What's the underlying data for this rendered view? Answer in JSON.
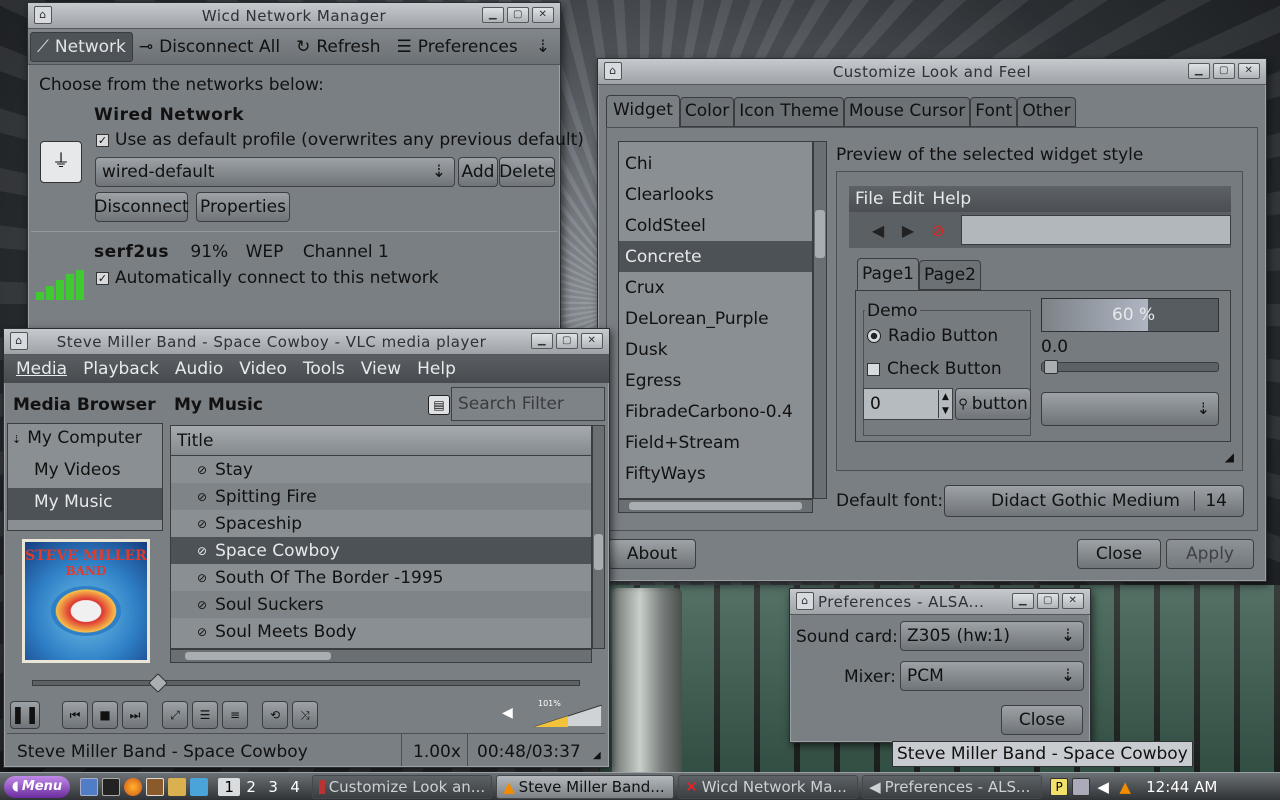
{
  "wicd": {
    "title": "Wicd Network Manager",
    "toolbar": {
      "network": "Network",
      "disconnect_all": "Disconnect All",
      "refresh": "Refresh",
      "preferences": "Preferences"
    },
    "prompt": "Choose from the networks below:",
    "wired": {
      "title": "Wired Network",
      "default_profile": "Use as default profile (overwrites any previous default)",
      "profile": "wired-default",
      "add": "Add",
      "delete": "Delete",
      "disconnect": "Disconnect",
      "properties": "Properties"
    },
    "wireless": {
      "ssid": "serf2us",
      "signal": "91%",
      "enc": "WEP",
      "channel": "Channel 1",
      "auto": "Automatically connect to this network"
    }
  },
  "clook": {
    "title": "Customize Look and Feel",
    "tabs": [
      "Widget",
      "Color",
      "Icon Theme",
      "Mouse Cursor",
      "Font",
      "Other"
    ],
    "themes": [
      "Chi",
      "Clearlooks",
      "ColdSteel",
      "Concrete",
      "Crux",
      "DeLorean_Purple",
      "Dusk",
      "Egress",
      "FibradeCarbono-0.4",
      "Field+Stream",
      "FiftyWays"
    ],
    "selected_theme": "Concrete",
    "preview_label": "Preview of the selected widget style",
    "preview": {
      "menu": [
        "File",
        "Edit",
        "Help"
      ],
      "tabs": [
        "Page1",
        "Page2"
      ],
      "frame": "Demo",
      "radio": "Radio Button",
      "check": "Check Button",
      "spin": "0",
      "button": "button",
      "progress": "60 %",
      "progress_value": 0.6,
      "scale": "0.0"
    },
    "font_label": "Default font:",
    "font_name": "Didact Gothic Medium",
    "font_size": "14",
    "about": "About",
    "close": "Close",
    "apply": "Apply"
  },
  "vlc": {
    "title": "Steve Miller Band - Space Cowboy - VLC media player",
    "menu": [
      "Media",
      "Playback",
      "Audio",
      "Video",
      "Tools",
      "View",
      "Help"
    ],
    "browser_title": "Media Browser",
    "browser_items": [
      "My Computer",
      "My Videos",
      "My Music"
    ],
    "album_art": {
      "line1": "STEVE MILLER",
      "line2": "BAND"
    },
    "panel_title": "My Music",
    "search_placeholder": "Search Filter",
    "col_title": "Title",
    "tracks": [
      "Stay",
      "Spitting Fire",
      "Spaceship",
      "Space Cowboy",
      "South Of The Border -1995",
      "Soul Suckers",
      "Soul Meets Body"
    ],
    "selected_track": "Space Cowboy",
    "volume": "101%",
    "status_title": "Steve Miller Band - Space Cowboy",
    "speed": "1.00x",
    "time": "00:48/03:37"
  },
  "alsa": {
    "title": "Preferences - ALSA...",
    "sound_card_label": "Sound card:",
    "sound_card": "Z305 (hw:1)",
    "mixer_label": "Mixer:",
    "mixer": "PCM",
    "close": "Close"
  },
  "tooltip": "Steve Miller Band - Space Cowboy",
  "taskbar": {
    "menu": "Menu",
    "workspaces": [
      "1",
      "2",
      "3",
      "4"
    ],
    "tasks": [
      "Customize Look an...",
      "Steve Miller Band...",
      "Wicd Network Ma...",
      "Preferences - ALS..."
    ],
    "clock": "12:44 AM"
  }
}
